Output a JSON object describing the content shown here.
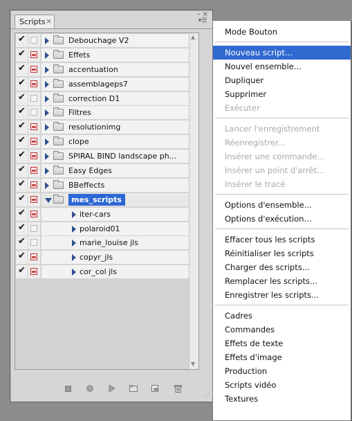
{
  "panel": {
    "tab_label": "Scripts",
    "tab_close": "×",
    "window_controls": "– ×",
    "menu_button": "▾☰"
  },
  "rows": [
    {
      "type": "group",
      "label": "Debouchage V2",
      "checked": true,
      "dialog": false,
      "expanded": false
    },
    {
      "type": "group",
      "label": "Effets",
      "checked": true,
      "dialog": true,
      "expanded": false
    },
    {
      "type": "group",
      "label": "accentuation",
      "checked": true,
      "dialog": true,
      "expanded": false
    },
    {
      "type": "group",
      "label": "assemblageps7",
      "checked": true,
      "dialog": true,
      "expanded": false
    },
    {
      "type": "group",
      "label": "correction D1",
      "checked": true,
      "dialog": false,
      "expanded": false
    },
    {
      "type": "group",
      "label": "Filtres",
      "checked": true,
      "dialog": false,
      "expanded": false
    },
    {
      "type": "group",
      "label": "resolutionimg",
      "checked": true,
      "dialog": true,
      "expanded": false
    },
    {
      "type": "group",
      "label": "clope",
      "checked": true,
      "dialog": true,
      "expanded": false
    },
    {
      "type": "group",
      "label": "SPIRAL BIND landscape ph...",
      "checked": true,
      "dialog": true,
      "expanded": false
    },
    {
      "type": "group",
      "label": "Easy Edges",
      "checked": true,
      "dialog": true,
      "expanded": false
    },
    {
      "type": "group",
      "label": "BBeffects",
      "checked": true,
      "dialog": true,
      "expanded": false
    },
    {
      "type": "group",
      "label": "mes_scripts",
      "checked": true,
      "dialog": true,
      "expanded": true,
      "selected": true
    },
    {
      "type": "action",
      "label": "iter-cars",
      "checked": true,
      "dialog": true
    },
    {
      "type": "action",
      "label": "polaroid01",
      "checked": true,
      "dialog": false
    },
    {
      "type": "action",
      "label": "marie_louise jls",
      "checked": true,
      "dialog": false
    },
    {
      "type": "action",
      "label": "copyr_jls",
      "checked": true,
      "dialog": true
    },
    {
      "type": "action",
      "label": "cor_col jls",
      "checked": true,
      "dialog": true
    }
  ],
  "toolbar": {
    "stop_icon": "stop-icon",
    "record_icon": "record-icon",
    "play_icon": "play-icon",
    "new_set_icon": "folder-icon",
    "new_script_icon": "new-page-icon",
    "delete_icon": "trash-icon"
  },
  "menu": {
    "groups": [
      [
        {
          "label": "Mode Bouton",
          "disabled": false
        }
      ],
      [
        {
          "label": "Nouveau script...",
          "disabled": false,
          "highlight": true
        },
        {
          "label": "Nouvel ensemble...",
          "disabled": false
        },
        {
          "label": "Dupliquer",
          "disabled": false
        },
        {
          "label": "Supprimer",
          "disabled": false
        },
        {
          "label": "Exécuter",
          "disabled": true
        }
      ],
      [
        {
          "label": "Lancer l'enregistrement",
          "disabled": true
        },
        {
          "label": "Réenregistrer...",
          "disabled": true
        },
        {
          "label": "Insérer une commande...",
          "disabled": true
        },
        {
          "label": "Insérer un point d'arrêt...",
          "disabled": true
        },
        {
          "label": "Insérer le tracé",
          "disabled": true
        }
      ],
      [
        {
          "label": "Options d'ensemble...",
          "disabled": false
        },
        {
          "label": "Options d'exécution...",
          "disabled": false
        }
      ],
      [
        {
          "label": "Effacer tous les scripts",
          "disabled": false
        },
        {
          "label": "Réinitialiser les scripts",
          "disabled": false
        },
        {
          "label": "Charger des scripts...",
          "disabled": false
        },
        {
          "label": "Remplacer les scripts...",
          "disabled": false
        },
        {
          "label": "Enregistrer les scripts...",
          "disabled": false
        }
      ],
      [
        {
          "label": "Cadres",
          "disabled": false
        },
        {
          "label": "Commandes",
          "disabled": false
        },
        {
          "label": "Effets de texte",
          "disabled": false
        },
        {
          "label": "Effets d'image",
          "disabled": false
        },
        {
          "label": "Production",
          "disabled": false
        },
        {
          "label": "Scripts vidéo",
          "disabled": false
        },
        {
          "label": "Textures",
          "disabled": false
        }
      ]
    ]
  },
  "colors": {
    "highlight": "#3069d0",
    "selection": "#2d67d3",
    "dialog_toggle": "#c03030",
    "disabled_text": "#a9a9a9"
  }
}
